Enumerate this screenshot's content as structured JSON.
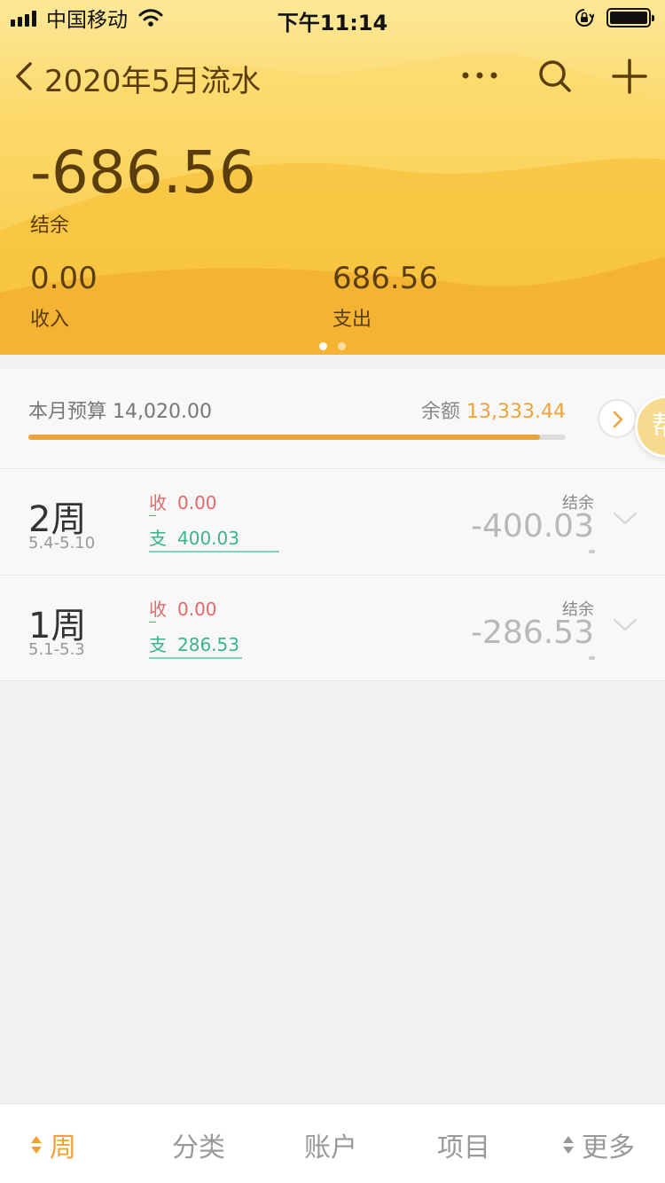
{
  "status_bar": {
    "carrier": "中国移动",
    "time": "下午11:14"
  },
  "nav": {
    "title": "2020年5月流水"
  },
  "summary": {
    "balance": "-686.56",
    "balance_label": "结余",
    "income": "0.00",
    "income_label": "收入",
    "expense": "686.56",
    "expense_label": "支出"
  },
  "budget": {
    "label": "本月预算",
    "amount": "14,020.00",
    "remaining_label": "余额",
    "remaining": "13,333.44",
    "progress_fraction": 0.952,
    "helper_badge_text": "帮"
  },
  "weeks": [
    {
      "name": "2周",
      "range": "5.4-5.10",
      "income_key": "收",
      "income": "0.00",
      "expense_key": "支",
      "expense": "400.03",
      "balance_label": "结余",
      "balance": "-400.03"
    },
    {
      "name": "1周",
      "range": "5.1-5.3",
      "income_key": "收",
      "income": "0.00",
      "expense_key": "支",
      "expense": "286.53",
      "balance_label": "结余",
      "balance": "-286.53"
    }
  ],
  "tabs": [
    {
      "label": "周",
      "active": true
    },
    {
      "label": "分类",
      "active": false
    },
    {
      "label": "账户",
      "active": false
    },
    {
      "label": "项目",
      "active": false
    },
    {
      "label": "更多",
      "active": false
    }
  ],
  "colors": {
    "accent": "#f0a23a",
    "header_text": "#5a3d0a",
    "income_red": "#e06a6a",
    "expense_green": "#3bb38f"
  },
  "icons": {
    "back": "chevron-left-icon",
    "more": "more-dots-icon",
    "search": "search-icon",
    "add": "plus-icon",
    "expand": "chevron-down-icon",
    "sort": "sort-icon"
  }
}
